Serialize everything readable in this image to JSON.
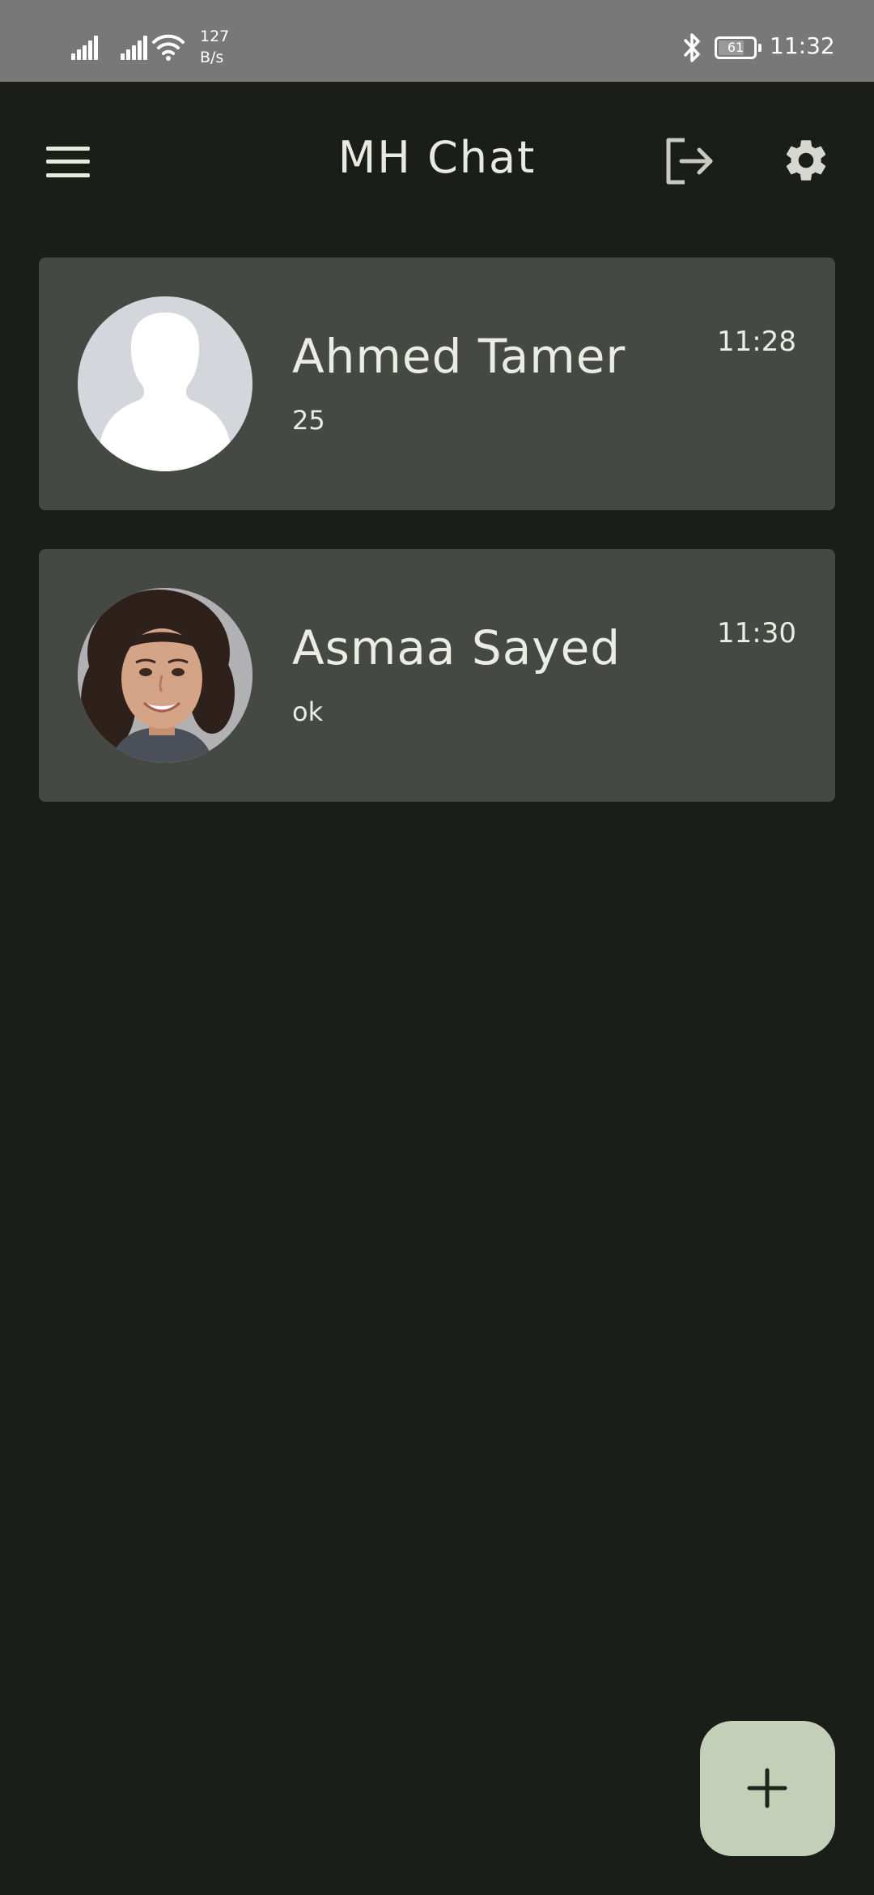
{
  "status_bar": {
    "network_speed_value": "127",
    "network_speed_unit": "B/s",
    "battery_level": "61",
    "time": "11:32"
  },
  "app_bar": {
    "title": "MH Chat",
    "icons": [
      "menu-icon",
      "logout-icon",
      "settings-icon"
    ]
  },
  "chats": [
    {
      "name": "Ahmed Tamer",
      "last_message": "25",
      "time": "11:28",
      "avatar": "default-avatar"
    },
    {
      "name": "Asmaa Sayed",
      "last_message": "ok",
      "time": "11:30",
      "avatar": "photo-avatar"
    }
  ],
  "fab": {
    "icon": "plus-icon"
  },
  "colors": {
    "background": "#1b1d19",
    "card": "#464943",
    "fab": "#c3cfb6",
    "status_bar": "#787878",
    "text": "#ecece6"
  }
}
